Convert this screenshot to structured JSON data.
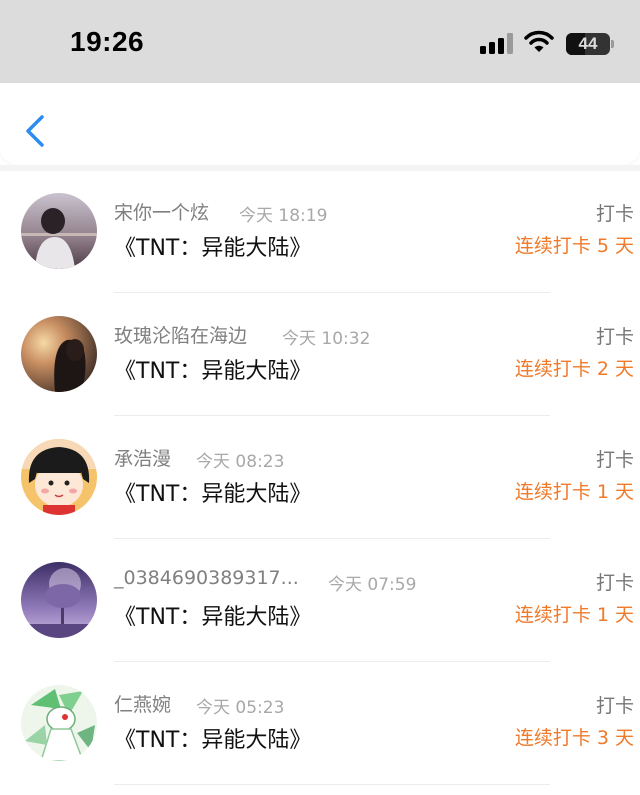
{
  "status_bar": {
    "time": "19:26",
    "battery": "44",
    "signal_icon": "signal-bars-icon",
    "wifi_icon": "wifi-icon",
    "battery_icon": "battery-icon"
  },
  "nav": {
    "back_icon": "chevron-left-icon",
    "accent_color": "#2d8cf0"
  },
  "colors": {
    "streak": "#f07a2a",
    "name": "#808080",
    "timestamp": "#a8a8a8"
  },
  "checkins": [
    {
      "user": "宋你一个炫",
      "time": "今天 18:19",
      "book": "《TNT：异能大陆》",
      "action": "打卡",
      "streak": "连续打卡 5 天"
    },
    {
      "user": "玫瑰沦陷在海边",
      "time": "今天 10:32",
      "book": "《TNT：异能大陆》",
      "action": "打卡",
      "streak": "连续打卡 2 天"
    },
    {
      "user": "承浩漫",
      "time": "今天 08:23",
      "book": "《TNT：异能大陆》",
      "action": "打卡",
      "streak": "连续打卡 1 天"
    },
    {
      "user": "_0384690389317...",
      "time": "今天 07:59",
      "book": "《TNT：异能大陆》",
      "action": "打卡",
      "streak": "连续打卡 1 天"
    },
    {
      "user": "仁燕婉",
      "time": "今天 05:23",
      "book": "《TNT：异能大陆》",
      "action": "打卡",
      "streak": "连续打卡 3 天"
    }
  ]
}
